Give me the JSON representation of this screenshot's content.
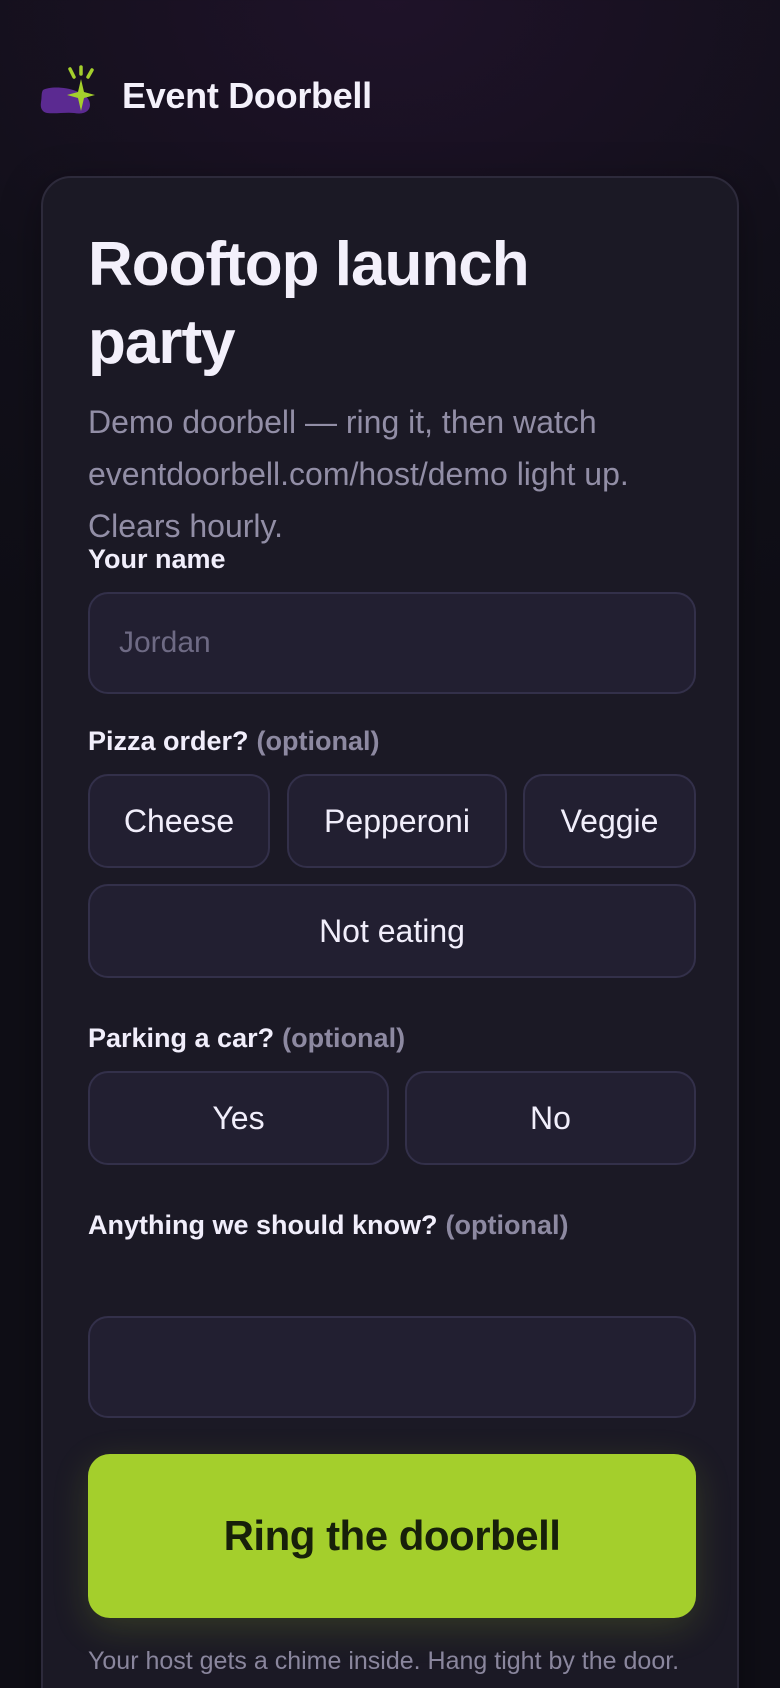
{
  "header": {
    "brand": "Event Doorbell",
    "logo_icon": "doorbell-sparkle-icon",
    "logo_colors": {
      "smear": "#5b2a91",
      "sparkle": "#a4cf2c"
    }
  },
  "event": {
    "title": "Rooftop launch party",
    "description": "Demo doorbell — ring it, then watch eventdoorbell.com/host/demo light up. Clears hourly."
  },
  "form": {
    "name": {
      "label": "Your name",
      "placeholder": "Jordan",
      "value": ""
    },
    "pizza": {
      "label": "Pizza order?",
      "optional": "(optional)",
      "options": [
        "Cheese",
        "Pepperoni",
        "Veggie",
        "Not eating"
      ]
    },
    "parking": {
      "label": "Parking a car?",
      "optional": "(optional)",
      "options": [
        "Yes",
        "No"
      ]
    },
    "notes": {
      "label": "Anything we should know?",
      "optional": "(optional)",
      "value": ""
    },
    "submit_label": "Ring the doorbell",
    "footnote": "Your host gets a chime inside. Hang tight by the door."
  },
  "colors": {
    "accent": "#a4cf2c",
    "background": "#12101a",
    "card": "#1b1925",
    "muted_text": "#928ea6"
  }
}
